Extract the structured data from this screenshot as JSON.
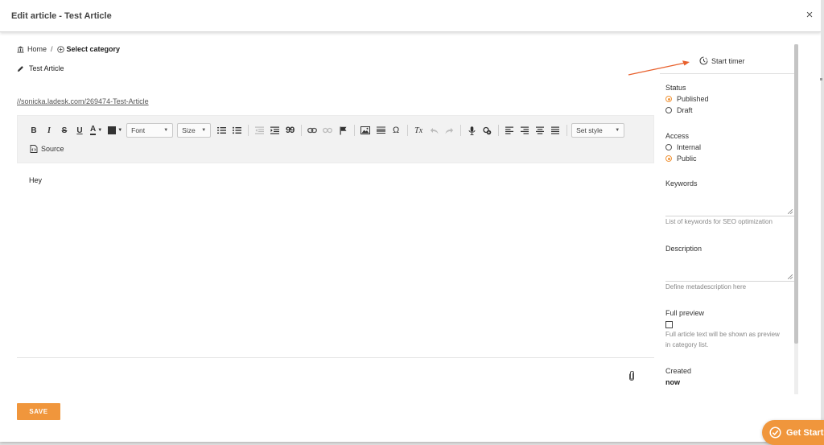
{
  "modal": {
    "title": "Edit article - Test Article",
    "close_glyph": "×"
  },
  "breadcrumb": {
    "home_label": "Home",
    "separator": "/",
    "category_label": "Select category"
  },
  "article": {
    "title": "Test Article",
    "url": "//sonicka.ladesk.com/269474-Test-Article",
    "content": "Hey"
  },
  "toolbar": {
    "bold_glyph": "B",
    "italic_glyph": "I",
    "strike_glyph": "S",
    "underline_glyph": "U",
    "text_color_glyph": "A",
    "font_label": "Font",
    "size_label": "Size",
    "blockquote_glyph": "99",
    "omega_glyph": "Ω",
    "clear_format_glyph": "Tx",
    "set_style_label": "Set style",
    "source_label": "Source"
  },
  "timer": {
    "label": "Start timer"
  },
  "sidebar": {
    "status": {
      "label": "Status",
      "options": [
        "Published",
        "Draft"
      ],
      "selected": "Published"
    },
    "access": {
      "label": "Access",
      "options": [
        "Internal",
        "Public"
      ],
      "selected": "Public"
    },
    "keywords": {
      "label": "Keywords",
      "hint": "List of keywords for SEO optimization"
    },
    "description": {
      "label": "Description",
      "hint": "Define metadescription here"
    },
    "full_preview": {
      "label": "Full preview",
      "checked": false,
      "hint_line1": "Full article text will be shown as preview",
      "hint_line2": "in category list."
    },
    "created": {
      "label": "Created",
      "value": "now"
    }
  },
  "save_button": {
    "label": "SAVE"
  },
  "get_started": {
    "label": "Get Start"
  },
  "colors": {
    "accent": "#f0963c",
    "arrow": "#e8602c"
  }
}
